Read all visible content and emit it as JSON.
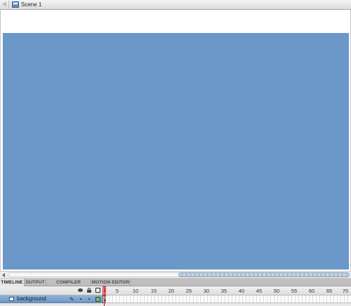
{
  "scene": {
    "name": "Scene 1"
  },
  "stage": {
    "color": "#6b97c9"
  },
  "panel_tabs": [
    "TIMELINE",
    "OUTPUT",
    "COMPILER ERRORS",
    "MOTION EDITOR"
  ],
  "timeline": {
    "current_frame": "1",
    "frame_numbers": [
      "5",
      "10",
      "15",
      "20",
      "25",
      "30",
      "35",
      "40",
      "45",
      "50",
      "55",
      "60",
      "65",
      "70"
    ],
    "layers": [
      {
        "name": "background",
        "pencil": "✎"
      }
    ]
  }
}
